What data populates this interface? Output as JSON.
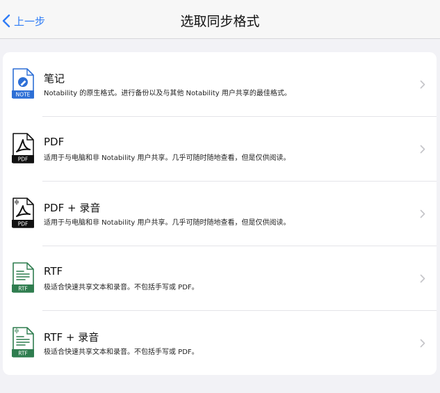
{
  "nav": {
    "back_label": "上一步",
    "title": "选取同步格式"
  },
  "formats": [
    {
      "title": "笔记",
      "subtitle": "Notability 的原生格式。进行备份以及与其他 Notability 用户共享的最佳格式。",
      "icon": "note-file-icon",
      "badge": "NOTE"
    },
    {
      "title": "PDF",
      "subtitle": "适用于与电脑和非 Notability 用户共享。几乎可随时随地查看，但是仅供阅读。",
      "icon": "pdf-file-icon",
      "badge": "PDF"
    },
    {
      "title": "PDF + 录音",
      "subtitle": "适用于与电脑和非 Notability 用户共享。几乎可随时随地查看，但是仅供阅读。",
      "icon": "pdf-audio-file-icon",
      "badge": "PDF"
    },
    {
      "title": "RTF",
      "subtitle": "极适合快速共享文本和录音。不包括手写或 PDF。",
      "icon": "rtf-file-icon",
      "badge": "RTF"
    },
    {
      "title": "RTF + 录音",
      "subtitle": "极适合快速共享文本和录音。不包括手写或 PDF。",
      "icon": "rtf-audio-file-icon",
      "badge": "RTF"
    }
  ],
  "colors": {
    "accent": "#2f7cf6",
    "note_blue": "#2d6fd6",
    "pdf_black": "#111111",
    "rtf_green": "#2f7d4f"
  }
}
